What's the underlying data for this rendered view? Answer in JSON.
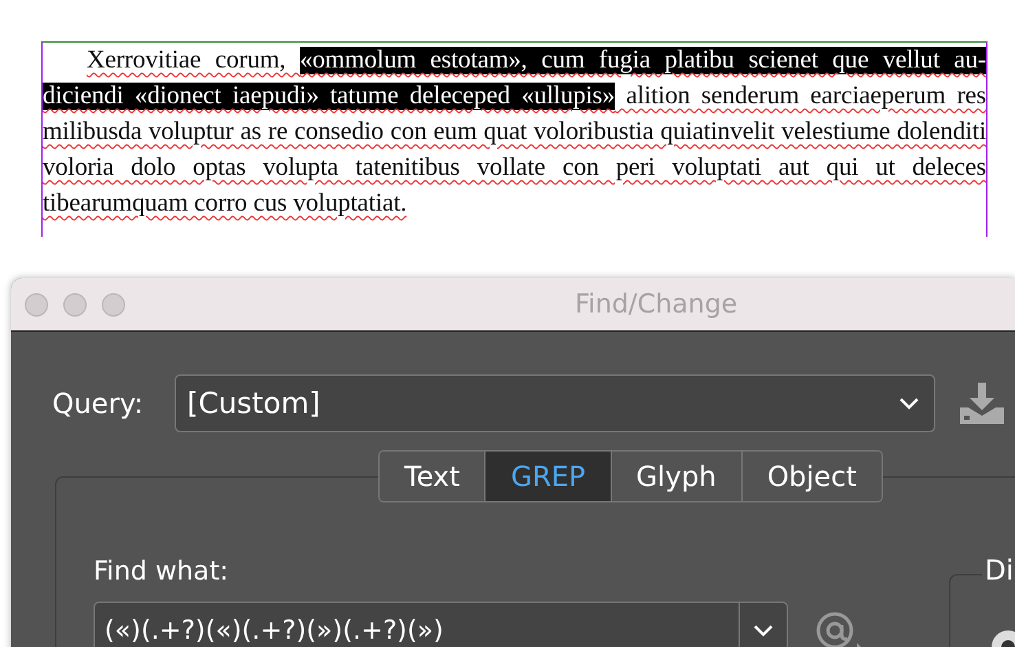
{
  "document": {
    "paragraph": [
      {
        "text": "Xerrovitiae corum, ",
        "selected": false
      },
      {
        "text": "«ommolum estotam», cum fugia platibu scienet que vellut au-diciendi «dionect iaepudi» tatume deleceped «ullupis»",
        "selected": true
      },
      {
        "text": " alition senderum earciaeperum res milibusda voluptur as re consedio con eum quat voloribustia quiatinvelit velestiume dolenditi voloria dolo optas volupta tatenitibus vollate con peri voluptati aut qui ut deleces tibearumquam corro cus voluptatiat.",
        "selected": false
      }
    ]
  },
  "dialog": {
    "title": "Find/Change",
    "query_label": "Query:",
    "query_value": "[Custom]",
    "tabs": [
      {
        "label": "Text",
        "selected": false
      },
      {
        "label": "GREP",
        "selected": true
      },
      {
        "label": "Glyph",
        "selected": false
      },
      {
        "label": "Object",
        "selected": false
      }
    ],
    "find_label": "Find what:",
    "find_value": "(«)(.+?)(«)(.+?)(»)(.+?)(»)",
    "side_group_label": "Di"
  }
}
